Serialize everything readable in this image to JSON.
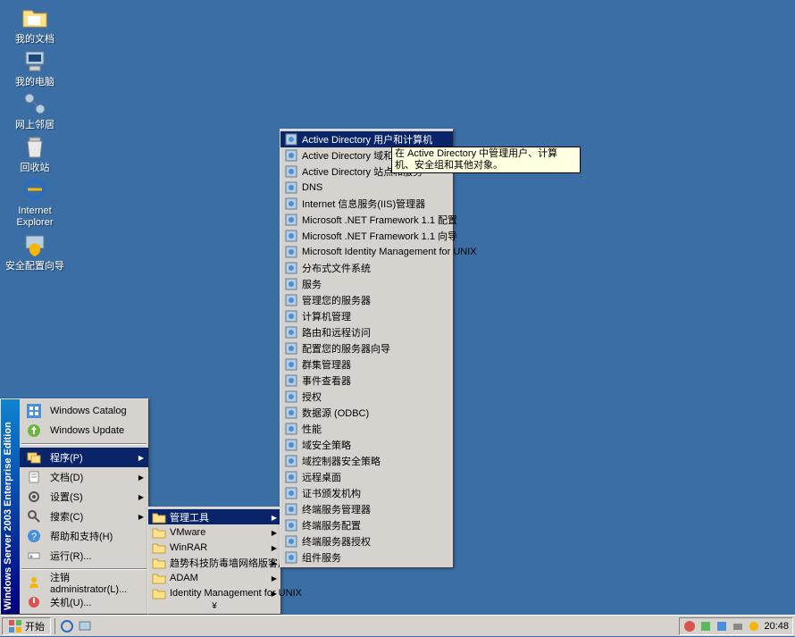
{
  "desktop_icons": {
    "mydocs": "我的文档",
    "mycomputer": "我的电脑",
    "network": "网上邻居",
    "recyclebin": "回收站",
    "ie_name": "Internet Explorer",
    "security": "安全配置向导"
  },
  "taskbar": {
    "start": "开始",
    "clock": "20:48"
  },
  "start_menu": {
    "sidebar": "Windows Server 2003 Enterprise Edition",
    "catalog": "Windows Catalog",
    "update": "Windows Update",
    "programs": "程序(P)",
    "documents": "文档(D)",
    "settings": "设置(S)",
    "search": "搜索(C)",
    "help": "帮助和支持(H)",
    "run": "运行(R)...",
    "logoff": "注销 administrator(L)...",
    "shutdown": "关机(U)..."
  },
  "programs_menu": {
    "items": [
      {
        "label": "管理工具",
        "arrow": true,
        "hl": true
      },
      {
        "label": "VMware",
        "arrow": true
      },
      {
        "label": "WinRAR",
        "arrow": true
      },
      {
        "label": "趋势科技防毒墙网络版客户端",
        "arrow": true
      },
      {
        "label": "ADAM",
        "arrow": true
      },
      {
        "label": "Identity Management for UNIX",
        "arrow": true
      }
    ],
    "expand": "¥"
  },
  "admin_tools_menu": {
    "items": [
      {
        "label": "Active Directory 用户和计算机",
        "hl": true
      },
      {
        "label": "Active Directory 域和信任关系"
      },
      {
        "label": "Active Directory 站点和服务"
      },
      {
        "label": "DNS"
      },
      {
        "label": "Internet 信息服务(IIS)管理器"
      },
      {
        "label": "Microsoft .NET Framework 1.1 配置"
      },
      {
        "label": "Microsoft .NET Framework 1.1 向导"
      },
      {
        "label": "Microsoft Identity Management for UNIX"
      },
      {
        "label": "分布式文件系统"
      },
      {
        "label": "服务"
      },
      {
        "label": "管理您的服务器"
      },
      {
        "label": "计算机管理"
      },
      {
        "label": "路由和远程访问"
      },
      {
        "label": "配置您的服务器向导"
      },
      {
        "label": "群集管理器"
      },
      {
        "label": "事件查看器"
      },
      {
        "label": "授权"
      },
      {
        "label": "数据源 (ODBC)"
      },
      {
        "label": "性能"
      },
      {
        "label": "域安全策略"
      },
      {
        "label": "域控制器安全策略"
      },
      {
        "label": "远程桌面"
      },
      {
        "label": "证书颁发机构"
      },
      {
        "label": "终端服务管理器"
      },
      {
        "label": "终端服务配置"
      },
      {
        "label": "终端服务器授权"
      },
      {
        "label": "组件服务"
      }
    ]
  },
  "tooltip_text": "在 Active Directory 中管理用户、计算机、安全组和其他对象。"
}
